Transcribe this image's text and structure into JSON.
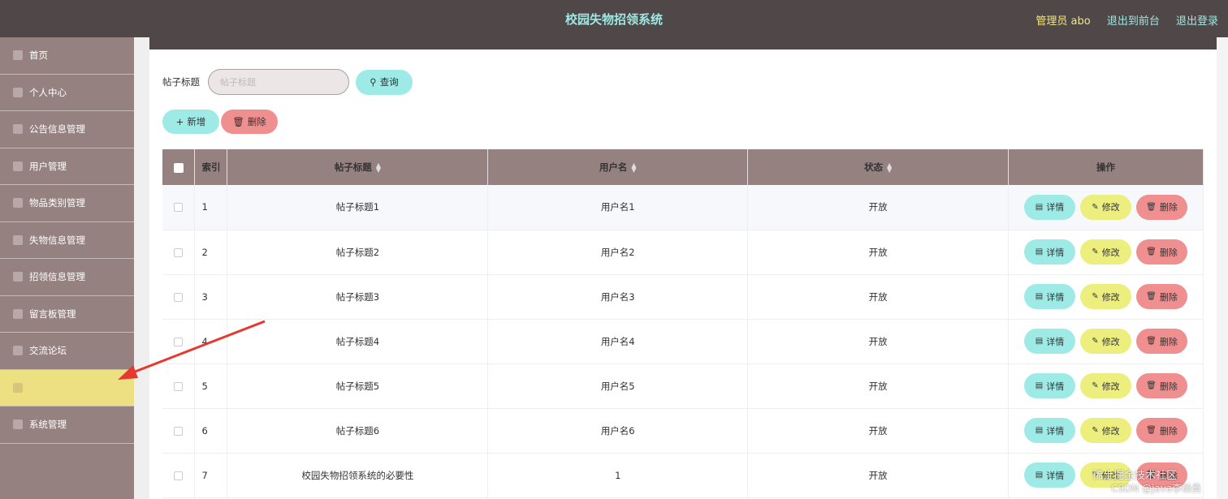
{
  "header": {
    "title": "校园失物招领系统",
    "admin": "管理员 abo",
    "front": "退出到前台",
    "logout": "退出登录"
  },
  "sidebar": {
    "items": [
      {
        "label": "首页",
        "icon": "home-icon"
      },
      {
        "label": "个人中心",
        "icon": "user-icon"
      },
      {
        "label": "公告信息管理",
        "icon": "notice-icon"
      },
      {
        "label": "用户管理",
        "icon": "users-icon"
      },
      {
        "label": "物品类别管理",
        "icon": "category-icon"
      },
      {
        "label": "失物信息管理",
        "icon": "lost-icon"
      },
      {
        "label": "招领信息管理",
        "icon": "found-icon"
      },
      {
        "label": "留言板管理",
        "icon": "message-icon"
      },
      {
        "label": "交流论坛",
        "icon": "forum-icon"
      },
      {
        "label": "",
        "icon": "active-icon",
        "active": true
      },
      {
        "label": "系统管理",
        "icon": "settings-icon"
      }
    ]
  },
  "search": {
    "label": "帖子标题",
    "placeholder": "帖子标题",
    "button": "查询"
  },
  "toolbar": {
    "add": "新增",
    "delete": "删除"
  },
  "table": {
    "headers": [
      "索引",
      "帖子标题",
      "用户名",
      "状态",
      "操作"
    ],
    "ops": {
      "detail": "详情",
      "edit": "修改",
      "remove": "删除"
    },
    "rows": [
      {
        "index": "1",
        "title": "帖子标题1",
        "user": "用户名1",
        "status": "开放"
      },
      {
        "index": "2",
        "title": "帖子标题2",
        "user": "用户名2",
        "status": "开放"
      },
      {
        "index": "3",
        "title": "帖子标题3",
        "user": "用户名3",
        "status": "开放"
      },
      {
        "index": "4",
        "title": "帖子标题4",
        "user": "用户名4",
        "status": "开放"
      },
      {
        "index": "5",
        "title": "帖子标题5",
        "user": "用户名5",
        "status": "开放"
      },
      {
        "index": "6",
        "title": "帖子标题6",
        "user": "用户名6",
        "status": "开放"
      },
      {
        "index": "7",
        "title": "校园失物招领系统的必要性",
        "user": "1",
        "status": "开放"
      }
    ]
  },
  "watermark": {
    "line1": "稀土掘金技术社区",
    "line2": "CSDN @java李杨勇"
  },
  "colors": {
    "topbar": "#504848",
    "sidebar": "#968181",
    "accent_cyan": "#9eeae6",
    "accent_yellow": "#ecee7e",
    "accent_red": "#f08f8f",
    "active_item": "#ede083"
  }
}
